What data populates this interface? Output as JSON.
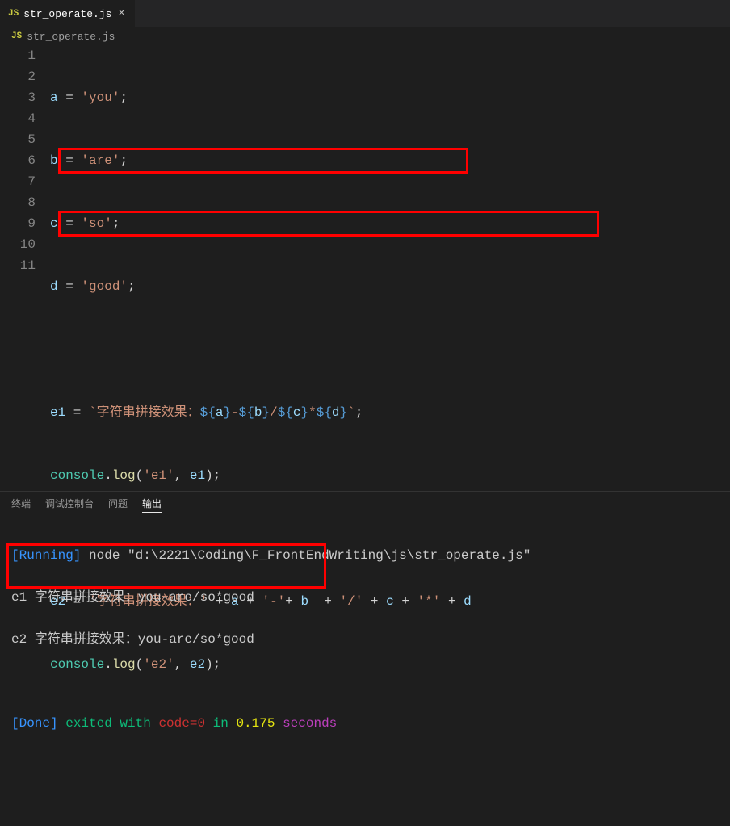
{
  "tab": {
    "filename": "str_operate.js",
    "badge": "JS"
  },
  "breadcrumb": {
    "filename": "str_operate.js",
    "badge": "JS"
  },
  "lines": {
    "n1": "1",
    "n2": "2",
    "n3": "3",
    "n4": "4",
    "n5": "5",
    "n6": "6",
    "n7": "7",
    "n8": "8",
    "n9": "9",
    "n10": "10",
    "n11": "11"
  },
  "code": {
    "l1": {
      "v": "a",
      "eq": " = ",
      "s": "'you'",
      "semi": ";"
    },
    "l2": {
      "v": "b",
      "eq": " = ",
      "s": "'are'",
      "semi": ";"
    },
    "l3": {
      "v": "c",
      "eq": " = ",
      "s": "'so'",
      "semi": ";"
    },
    "l4": {
      "v": "d",
      "eq": " = ",
      "s": "'good'",
      "semi": ";"
    },
    "l6": {
      "v": "e1",
      "eq": " = ",
      "bt1": "`字符串拼接效果：",
      "do1": "${",
      "va": "a",
      "dc1": "}",
      "dash": "-",
      "do2": "${",
      "vb": "b",
      "dc2": "}",
      "slash": "/",
      "do3": "${",
      "vc": "c",
      "dc3": "}",
      "star": "*",
      "do4": "${",
      "vd": "d",
      "dc4": "}",
      "bt2": "`",
      "semi": ";"
    },
    "l7": {
      "obj": "console",
      "dot": ".",
      "fn": "log",
      "op": "(",
      "s": "'e1'",
      "comma": ", ",
      "v": "e1",
      "cp": ");"
    },
    "l9": {
      "v": "e2",
      "eq": " = ",
      "s1": "'字符串拼接效果：'",
      "p1": " + ",
      "va": "a",
      "p2": " + ",
      "s2": "'-'",
      "p3": "+ ",
      "vb": "b",
      "p4": "  + ",
      "s3": "'/'",
      "p5": " + ",
      "vc": "c",
      "p6": " + ",
      "s4": "'*'",
      "p7": " + ",
      "vd": "d"
    },
    "l10": {
      "obj": "console",
      "dot": ".",
      "fn": "log",
      "op": "(",
      "s": "'e2'",
      "comma": ", ",
      "v": "e2",
      "cp": ");"
    }
  },
  "panel": {
    "tabs": {
      "terminal": "终端",
      "debug": "调试控制台",
      "problems": "问题",
      "output": "输出"
    }
  },
  "terminal": {
    "running": "[Running]",
    "cmd": " node \"d:\\2221\\Coding\\F_FrontEndWriting\\js\\str_operate.js\"",
    "out1": "e1 字符串拼接效果：you-are/so*good",
    "out2": "e2 字符串拼接效果：you-are/so*good",
    "done": "[Done]",
    "exited": " exited with ",
    "code": "code=0",
    "in": " in ",
    "time": "0.175",
    "seconds": " seconds"
  }
}
